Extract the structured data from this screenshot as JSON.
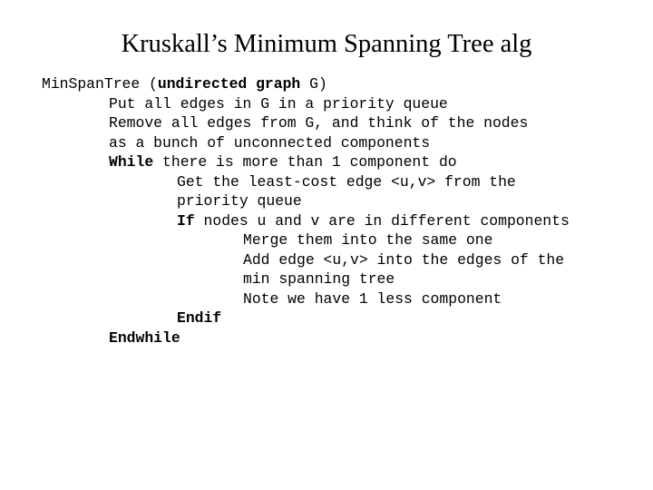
{
  "slide": {
    "title": "Kruskall’s Minimum Spanning Tree alg",
    "background_color": "#ffffff",
    "text_color": "#000000",
    "pseudocode": {
      "lines": [
        {
          "indent": 0,
          "segments": [
            {
              "text": "MinSpanTree (",
              "bold": false
            },
            {
              "text": "undirected graph",
              "bold": true
            },
            {
              "text": " G)",
              "bold": false
            }
          ],
          "plain": "MinSpanTree (undirected graph G)"
        },
        {
          "indent": 1,
          "segments": [
            {
              "text": "Put all edges in G in a priority queue",
              "bold": false
            }
          ],
          "plain": "Put all edges in G in a priority queue"
        },
        {
          "indent": 1,
          "segments": [
            {
              "text": "Remove all edges from G, and think of the nodes",
              "bold": false
            }
          ],
          "plain": "Remove all edges from G, and think of the nodes"
        },
        {
          "indent": 1,
          "segments": [
            {
              "text": "as a bunch of unconnected components",
              "bold": false
            }
          ],
          "plain": "as a bunch of unconnected components"
        },
        {
          "indent": 1,
          "segments": [
            {
              "text": "While",
              "bold": true
            },
            {
              "text": " there is more than 1 component do",
              "bold": false
            }
          ],
          "plain": "While there is more than 1 component do"
        },
        {
          "indent": 2,
          "segments": [
            {
              "text": "Get the least-cost edge <u,v> from the",
              "bold": false
            }
          ],
          "plain": "Get the least-cost edge <u,v> from the"
        },
        {
          "indent": 2,
          "segments": [
            {
              "text": "priority queue",
              "bold": false
            }
          ],
          "plain": "priority queue"
        },
        {
          "indent": 2,
          "segments": [
            {
              "text": "If",
              "bold": true
            },
            {
              "text": " nodes u and v are in different components",
              "bold": false
            }
          ],
          "plain": "If nodes u and v are in different components"
        },
        {
          "indent": 3,
          "segments": [
            {
              "text": "Merge them into the same one",
              "bold": false
            }
          ],
          "plain": "Merge them into the same one"
        },
        {
          "indent": 3,
          "segments": [
            {
              "text": "Add edge <u,v> into the edges of the",
              "bold": false
            }
          ],
          "plain": "Add edge <u,v> into the edges of the"
        },
        {
          "indent": 3,
          "segments": [
            {
              "text": "min spanning tree",
              "bold": false
            }
          ],
          "plain": "min spanning tree"
        },
        {
          "indent": 3,
          "segments": [
            {
              "text": "Note we have 1 less component",
              "bold": false
            }
          ],
          "plain": "Note we have 1 less component"
        },
        {
          "indent": 2,
          "segments": [
            {
              "text": "Endif",
              "bold": true
            }
          ],
          "plain": "Endif"
        },
        {
          "indent": 1,
          "segments": [
            {
              "text": "Endwhile",
              "bold": true
            }
          ],
          "plain": "Endwhile"
        }
      ]
    }
  }
}
